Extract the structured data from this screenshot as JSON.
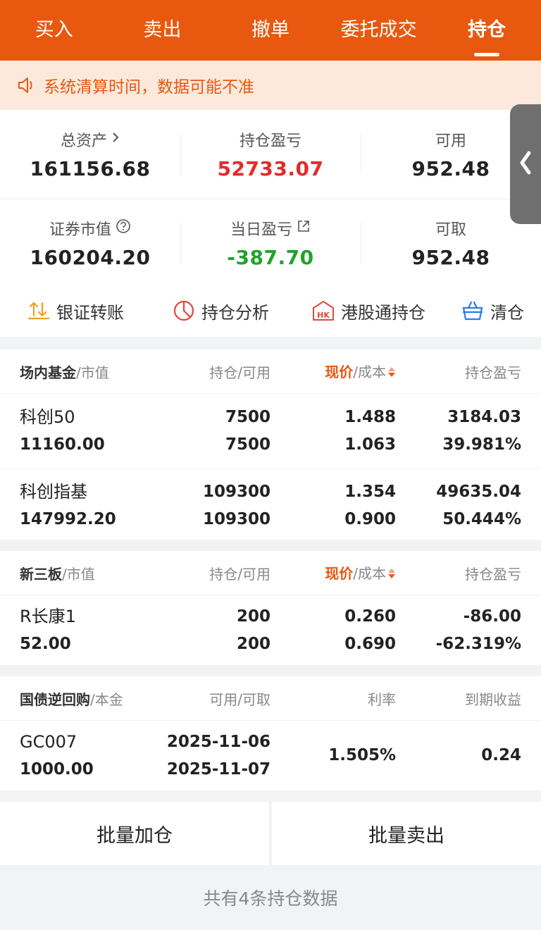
{
  "tabs": [
    "买入",
    "卖出",
    "撤单",
    "委托成交",
    "持仓"
  ],
  "active_tab": "持仓",
  "notice": "系统清算时间，数据可能不准",
  "summary": {
    "total_assets_label": "总资产",
    "total_assets": "161156.68",
    "position_pnl_label": "持仓盈亏",
    "position_pnl": "52733.07",
    "available_label": "可用",
    "available": "952.48",
    "market_value_label": "证券市值",
    "market_value": "160204.20",
    "daily_pnl_label": "当日盈亏",
    "daily_pnl": "-387.70",
    "withdrawable_label": "可取",
    "withdrawable": "952.48"
  },
  "actions": [
    "银证转账",
    "持仓分析",
    "港股通持仓",
    "清仓"
  ],
  "fund_section": {
    "h1": "场内基金",
    "h1b": "/市值",
    "h2": "持仓/可用",
    "h3a": "现价",
    "h3b": "/成本",
    "h4": "持仓盈亏",
    "rows": [
      {
        "name": "科创50",
        "mv": "11160.00",
        "pos": "7500",
        "avail": "7500",
        "price": "1.488",
        "cost": "1.063",
        "pnl": "3184.03",
        "pct": "39.981%"
      },
      {
        "name": "科创指基",
        "mv": "147992.20",
        "pos": "109300",
        "avail": "109300",
        "price": "1.354",
        "cost": "0.900",
        "pnl": "49635.04",
        "pct": "50.444%"
      }
    ]
  },
  "neeq_section": {
    "h1": "新三板",
    "h1b": "/市值",
    "h2": "持仓/可用",
    "h3a": "现价",
    "h3b": "/成本",
    "h4": "持仓盈亏",
    "rows": [
      {
        "name": "R长康1",
        "mv": "52.00",
        "pos": "200",
        "avail": "200",
        "price": "0.260",
        "cost": "0.690",
        "pnl": "-86.00",
        "pct": "-62.319%"
      }
    ]
  },
  "repo_section": {
    "h1": "国债逆回购",
    "h1b": "/本金",
    "h2": "可用/可取",
    "h3": "利率",
    "h4": "到期收益",
    "rows": [
      {
        "name": "GC007",
        "principal": "1000.00",
        "avail_date": "2025-11-06",
        "withdraw_date": "2025-11-07",
        "rate": "1.505%",
        "income": "0.24"
      }
    ]
  },
  "buttons": {
    "add": "批量加仓",
    "sell": "批量卖出"
  },
  "footer": "共有4条持仓数据",
  "colors": {
    "brand": "#e8580f",
    "up": "#e42a2a",
    "down": "#1ea42a"
  },
  "icons": [
    "speaker-icon",
    "chevron-right-icon",
    "help-circle-icon",
    "external-link-icon",
    "transfer-icon",
    "pie-chart-icon",
    "hk-icon",
    "basket-icon",
    "sort-icon",
    "chevron-left-icon"
  ]
}
